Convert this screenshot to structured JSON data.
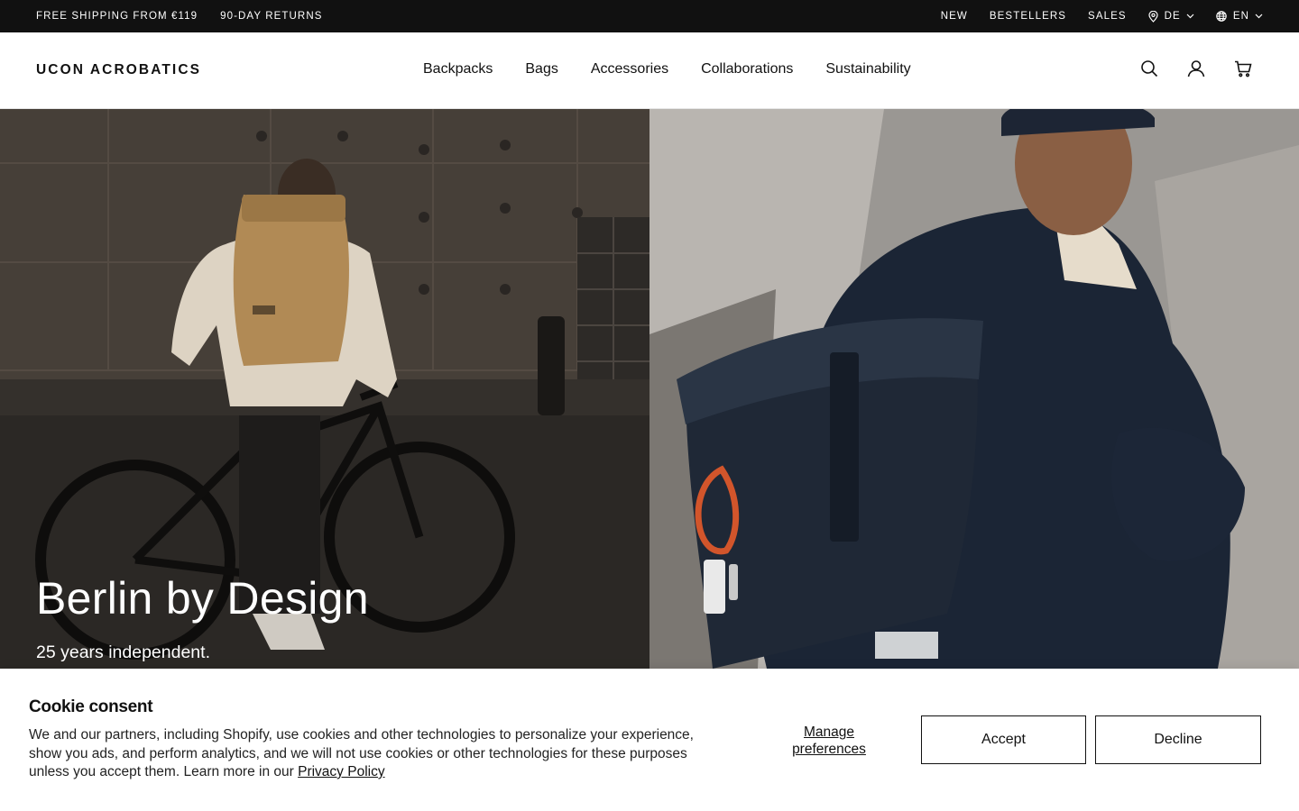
{
  "announcement": {
    "left": [
      "FREE SHIPPING FROM €119",
      "90-DAY RETURNS"
    ],
    "links": [
      "NEW",
      "BESTELLERS",
      "SALES"
    ],
    "country": "DE",
    "language": "EN",
    "icons": {
      "location": "map-pin-icon",
      "language": "globe-icon",
      "dropdown": "chevron-down-icon"
    }
  },
  "header": {
    "logo": "UCON ACROBATICS",
    "nav": [
      "Backpacks",
      "Bags",
      "Accessories",
      "Collaborations",
      "Sustainability"
    ],
    "icons": [
      "search-icon",
      "account-icon",
      "cart-icon"
    ]
  },
  "hero": {
    "title": "Berlin by Design",
    "subtitle": "25 years independent."
  },
  "cookie": {
    "title": "Cookie consent",
    "text": "We and our partners, including Shopify, use cookies and other technologies to personalize your experience, show you ads, and perform analytics, and we will not use cookies or other technologies for these purposes unless you accept them. Learn more in our ",
    "privacy_link": "Privacy Policy",
    "manage_label": "Manage preferences",
    "accept_label": "Accept",
    "decline_label": "Decline"
  }
}
